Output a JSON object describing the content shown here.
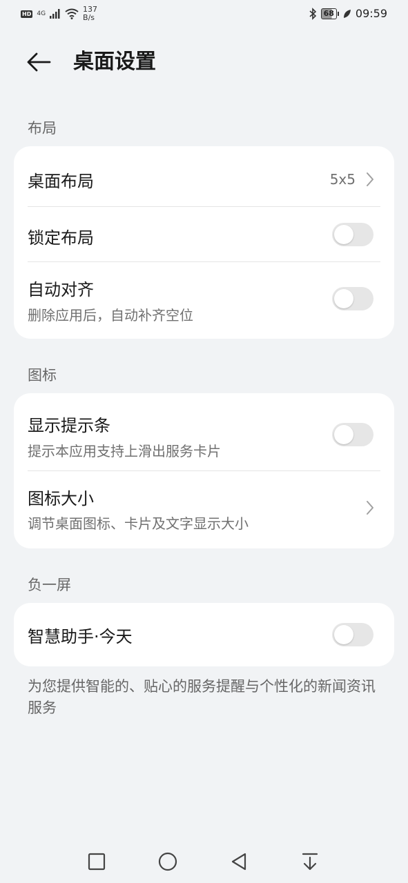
{
  "status_bar": {
    "hd": "HD",
    "network_type": "4G",
    "speed_value": "137",
    "speed_unit": "B/s",
    "battery_level": "68",
    "time": "09:59"
  },
  "header": {
    "title": "桌面设置"
  },
  "sections": [
    {
      "label": "布局",
      "rows": [
        {
          "title": "桌面布局",
          "value": "5x5",
          "control": "chevron"
        },
        {
          "title": "锁定布局",
          "control": "toggle",
          "on": false
        },
        {
          "title": "自动对齐",
          "subtitle": "删除应用后，自动补齐空位",
          "control": "toggle",
          "on": false
        }
      ]
    },
    {
      "label": "图标",
      "rows": [
        {
          "title": "显示提示条",
          "subtitle": "提示本应用支持上滑出服务卡片",
          "control": "toggle",
          "on": false
        },
        {
          "title": "图标大小",
          "subtitle": "调节桌面图标、卡片及文字显示大小",
          "control": "chevron"
        }
      ]
    },
    {
      "label": "负一屏",
      "rows": [
        {
          "title": "智慧助手·今天",
          "control": "toggle",
          "on": false
        }
      ]
    }
  ],
  "footnote": "为您提供智能的、贴心的服务提醒与个性化的新闻资讯服务",
  "colors": {
    "background": "#f1f3f5",
    "card": "#ffffff",
    "toggle_off": "#e6e6e6"
  }
}
